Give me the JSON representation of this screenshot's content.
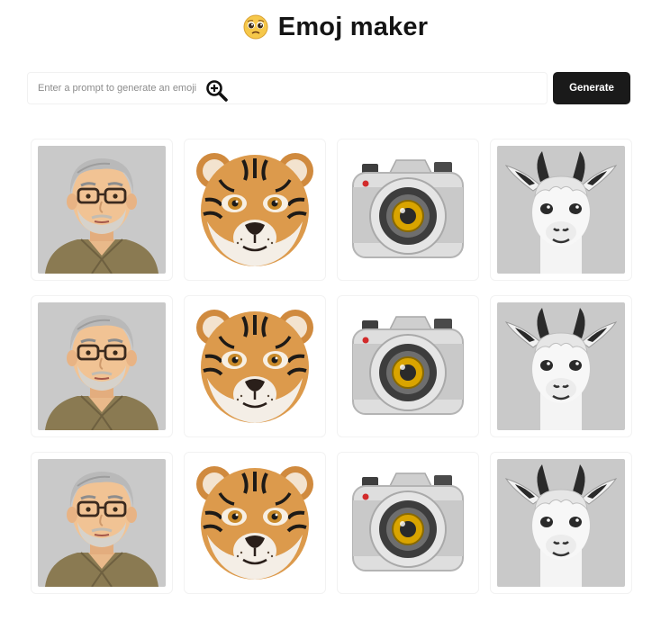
{
  "header": {
    "logo_icon": "pleading-face-icon",
    "title": "Emoj maker"
  },
  "prompt": {
    "placeholder": "Enter a prompt to generate an emoji",
    "value": "",
    "generate_label": "Generate"
  },
  "grid": {
    "columns": 4,
    "rows": 3,
    "tiles": [
      {
        "icon": "man-with-glasses-emoji-icon"
      },
      {
        "icon": "tiger-emoji-icon"
      },
      {
        "icon": "camera-emoji-icon"
      },
      {
        "icon": "llama-emoji-icon"
      },
      {
        "icon": "man-with-glasses-emoji-icon"
      },
      {
        "icon": "tiger-emoji-icon"
      },
      {
        "icon": "camera-emoji-icon"
      },
      {
        "icon": "llama-emoji-icon"
      },
      {
        "icon": "man-with-glasses-emoji-icon"
      },
      {
        "icon": "tiger-emoji-icon"
      },
      {
        "icon": "camera-emoji-icon"
      },
      {
        "icon": "llama-emoji-icon"
      }
    ]
  },
  "colors": {
    "button_bg": "#1a1a1a",
    "tile_gray_bg": "#c9c9c9",
    "tiger_orange": "#d9913e",
    "camera_gray": "#d8d8d8",
    "lens_gold": "#d9a400"
  }
}
